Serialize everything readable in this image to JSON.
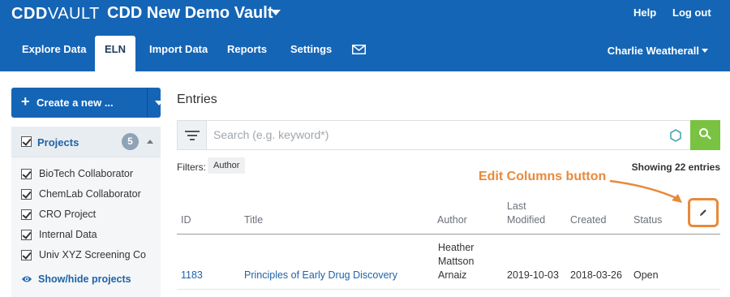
{
  "header": {
    "logo_bold": "CDD",
    "logo_light": "VAULT",
    "vault_name": "CDD New Demo Vault",
    "help": "Help",
    "logout": "Log out",
    "user": "Charlie Weatherall"
  },
  "nav": {
    "tabs": [
      {
        "label": "Explore Data",
        "active": false
      },
      {
        "label": "ELN",
        "active": true
      },
      {
        "label": "Import Data",
        "active": false
      },
      {
        "label": "Reports",
        "active": false
      },
      {
        "label": "Settings",
        "active": false
      }
    ],
    "mail_icon": "envelope-icon"
  },
  "sidebar": {
    "create_label": "Create a new ...",
    "projects_title": "Projects",
    "projects_count": "5",
    "projects": [
      {
        "label": "BioTech Collaborator",
        "checked": true
      },
      {
        "label": "ChemLab Collaborator",
        "checked": true
      },
      {
        "label": "CRO Project",
        "checked": true
      },
      {
        "label": "Internal Data",
        "checked": true
      },
      {
        "label": "Univ XYZ Screening Co",
        "checked": true
      }
    ],
    "show_hide": "Show/hide projects"
  },
  "main": {
    "title": "Entries",
    "search_placeholder": "Search (e.g. keyword*)",
    "filters_label": "Filters:",
    "filter_chip": "Author",
    "showing": "Showing 22 entries",
    "annotation": "Edit Columns button",
    "columns": {
      "id": "ID",
      "title": "Title",
      "author": "Author",
      "last": "Last",
      "modified": "Modified",
      "created": "Created",
      "status": "Status"
    },
    "rows": [
      {
        "id": "1183",
        "title": "Principles of Early Drug Discovery",
        "author_line1": "Heather",
        "author_line2": "Mattson",
        "author_line3": "Arnaiz",
        "last_modified": "2019-10-03",
        "created": "2018-03-26",
        "status": "Open"
      }
    ]
  },
  "colors": {
    "brand_blue": "#1565b6",
    "search_green": "#7ac242",
    "annotation_orange": "#e8893a",
    "link_blue": "#1f63a8"
  }
}
